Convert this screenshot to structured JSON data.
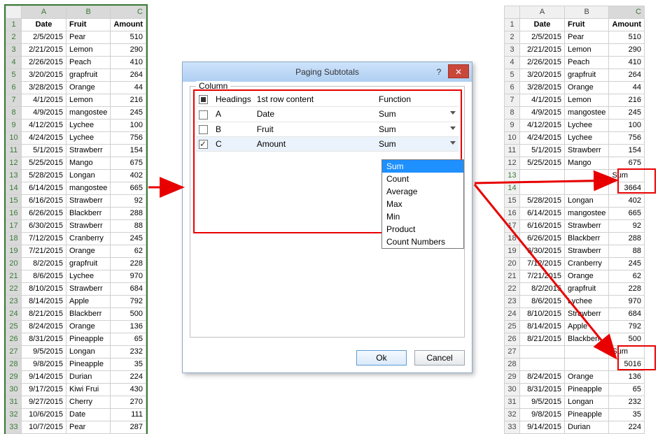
{
  "left": {
    "cols": [
      "A",
      "B",
      "C"
    ],
    "headers": [
      "Date",
      "Fruit",
      "Amount"
    ],
    "rows": [
      {
        "n": 2,
        "d": "2/5/2015",
        "f": "Pear",
        "a": 510
      },
      {
        "n": 3,
        "d": "2/21/2015",
        "f": "Lemon",
        "a": 290
      },
      {
        "n": 4,
        "d": "2/26/2015",
        "f": "Peach",
        "a": 410
      },
      {
        "n": 5,
        "d": "3/20/2015",
        "f": "grapfruit",
        "a": 264
      },
      {
        "n": 6,
        "d": "3/28/2015",
        "f": "Orange",
        "a": 44
      },
      {
        "n": 7,
        "d": "4/1/2015",
        "f": "Lemon",
        "a": 216
      },
      {
        "n": 8,
        "d": "4/9/2015",
        "f": "mangosteen",
        "a": 245
      },
      {
        "n": 9,
        "d": "4/12/2015",
        "f": "Lychee",
        "a": 100
      },
      {
        "n": 10,
        "d": "4/24/2015",
        "f": "Lychee",
        "a": 756
      },
      {
        "n": 11,
        "d": "5/1/2015",
        "f": "Strawberry",
        "a": 154
      },
      {
        "n": 12,
        "d": "5/25/2015",
        "f": "Mango",
        "a": 675
      },
      {
        "n": 13,
        "d": "5/28/2015",
        "f": "Longan",
        "a": 402
      },
      {
        "n": 14,
        "d": "6/14/2015",
        "f": "mangosteen",
        "a": 665
      },
      {
        "n": 15,
        "d": "6/16/2015",
        "f": "Strawberry",
        "a": 92
      },
      {
        "n": 16,
        "d": "6/26/2015",
        "f": "Blackberry",
        "a": 288
      },
      {
        "n": 17,
        "d": "6/30/2015",
        "f": "Strawberry",
        "a": 88
      },
      {
        "n": 18,
        "d": "7/12/2015",
        "f": "Cranberry",
        "a": 245
      },
      {
        "n": 19,
        "d": "7/21/2015",
        "f": "Orange",
        "a": 62
      },
      {
        "n": 20,
        "d": "8/2/2015",
        "f": "grapfruit",
        "a": 228
      },
      {
        "n": 21,
        "d": "8/6/2015",
        "f": "Lychee",
        "a": 970
      },
      {
        "n": 22,
        "d": "8/10/2015",
        "f": "Strawberry",
        "a": 684
      },
      {
        "n": 23,
        "d": "8/14/2015",
        "f": "Apple",
        "a": 792
      },
      {
        "n": 24,
        "d": "8/21/2015",
        "f": "Blackberry",
        "a": 500
      },
      {
        "n": 25,
        "d": "8/24/2015",
        "f": "Orange",
        "a": 136
      },
      {
        "n": 26,
        "d": "8/31/2015",
        "f": "Pineapple",
        "a": 65
      },
      {
        "n": 27,
        "d": "9/5/2015",
        "f": "Longan",
        "a": 232
      },
      {
        "n": 28,
        "d": "9/8/2015",
        "f": "Pineapple",
        "a": 35
      },
      {
        "n": 29,
        "d": "9/14/2015",
        "f": "Durian",
        "a": 224
      },
      {
        "n": 30,
        "d": "9/17/2015",
        "f": "Kiwi Fruit",
        "a": 430
      },
      {
        "n": 31,
        "d": "9/27/2015",
        "f": "Cherry",
        "a": 270
      },
      {
        "n": 32,
        "d": "10/6/2015",
        "f": "Date",
        "a": 111
      },
      {
        "n": 33,
        "d": "10/7/2015",
        "f": "Pear",
        "a": 287
      }
    ]
  },
  "right": {
    "cols": [
      "A",
      "B",
      "C"
    ],
    "headers": [
      "Date",
      "Fruit",
      "Amount"
    ],
    "rows": [
      {
        "n": 2,
        "d": "2/5/2015",
        "f": "Pear",
        "a": "510"
      },
      {
        "n": 3,
        "d": "2/21/2015",
        "f": "Lemon",
        "a": "290"
      },
      {
        "n": 4,
        "d": "2/26/2015",
        "f": "Peach",
        "a": "410"
      },
      {
        "n": 5,
        "d": "3/20/2015",
        "f": "grapfruit",
        "a": "264"
      },
      {
        "n": 6,
        "d": "3/28/2015",
        "f": "Orange",
        "a": "44"
      },
      {
        "n": 7,
        "d": "4/1/2015",
        "f": "Lemon",
        "a": "216"
      },
      {
        "n": 8,
        "d": "4/9/2015",
        "f": "mangosteen",
        "a": "245"
      },
      {
        "n": 9,
        "d": "4/12/2015",
        "f": "Lychee",
        "a": "100"
      },
      {
        "n": 10,
        "d": "4/24/2015",
        "f": "Lychee",
        "a": "756"
      },
      {
        "n": 11,
        "d": "5/1/2015",
        "f": "Strawberry",
        "a": "154"
      },
      {
        "n": 12,
        "d": "5/25/2015",
        "f": "Mango",
        "a": "675"
      },
      {
        "n": 13,
        "d": "",
        "f": "",
        "a": "Sum",
        "sum": true
      },
      {
        "n": 14,
        "d": "",
        "f": "",
        "a": "3664",
        "sum": true
      },
      {
        "n": 15,
        "d": "5/28/2015",
        "f": "Longan",
        "a": "402"
      },
      {
        "n": 16,
        "d": "6/14/2015",
        "f": "mangosteen",
        "a": "665"
      },
      {
        "n": 17,
        "d": "6/16/2015",
        "f": "Strawberry",
        "a": "92"
      },
      {
        "n": 18,
        "d": "6/26/2015",
        "f": "Blackberry",
        "a": "288"
      },
      {
        "n": 19,
        "d": "6/30/2015",
        "f": "Strawberry",
        "a": "88"
      },
      {
        "n": 20,
        "d": "7/12/2015",
        "f": "Cranberry",
        "a": "245"
      },
      {
        "n": 21,
        "d": "7/21/2015",
        "f": "Orange",
        "a": "62"
      },
      {
        "n": 22,
        "d": "8/2/2015",
        "f": "grapfruit",
        "a": "228"
      },
      {
        "n": 23,
        "d": "8/6/2015",
        "f": "Lychee",
        "a": "970"
      },
      {
        "n": 24,
        "d": "8/10/2015",
        "f": "Strawberry",
        "a": "684"
      },
      {
        "n": 25,
        "d": "8/14/2015",
        "f": "Apple",
        "a": "792"
      },
      {
        "n": 26,
        "d": "8/21/2015",
        "f": "Blackberry",
        "a": "500"
      },
      {
        "n": 27,
        "d": "",
        "f": "",
        "a": "Sum",
        "sum": true
      },
      {
        "n": 28,
        "d": "",
        "f": "",
        "a": "5016",
        "sum": true
      },
      {
        "n": 29,
        "d": "8/24/2015",
        "f": "Orange",
        "a": "136"
      },
      {
        "n": 30,
        "d": "8/31/2015",
        "f": "Pineapple",
        "a": "65"
      },
      {
        "n": 31,
        "d": "9/5/2015",
        "f": "Longan",
        "a": "232"
      },
      {
        "n": 32,
        "d": "9/8/2015",
        "f": "Pineapple",
        "a": "35"
      },
      {
        "n": 33,
        "d": "9/14/2015",
        "f": "Durian",
        "a": "224"
      }
    ]
  },
  "dialog": {
    "title": "Paging Subtotals",
    "group": "Column",
    "headers": {
      "chk": "",
      "col": "Headings",
      "content": "1st row content",
      "func": "Function"
    },
    "rows": [
      {
        "checked": false,
        "col": "A",
        "content": "Date",
        "func": "Sum"
      },
      {
        "checked": false,
        "col": "B",
        "content": "Fruit",
        "func": "Sum"
      },
      {
        "checked": true,
        "col": "C",
        "content": "Amount",
        "func": "Sum"
      }
    ],
    "dropdown": [
      "Sum",
      "Count",
      "Average",
      "Max",
      "Min",
      "Product",
      "Count Numbers"
    ],
    "ok": "Ok",
    "cancel": "Cancel"
  }
}
